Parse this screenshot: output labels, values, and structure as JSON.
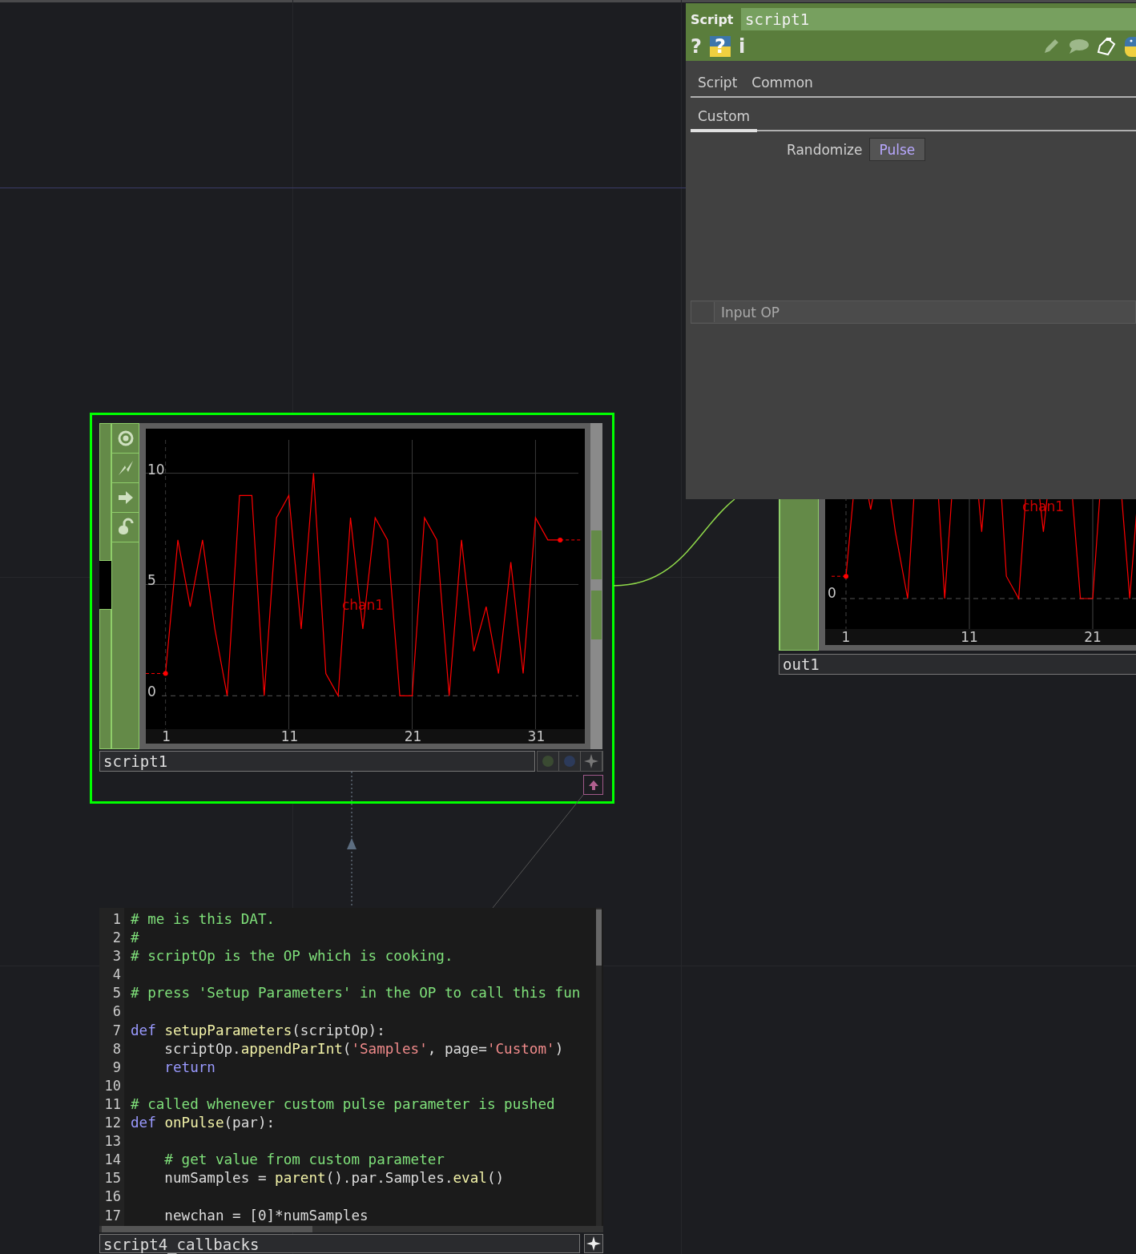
{
  "parameter_panel": {
    "type_label": "Script",
    "name": "script1",
    "header_buttons": [
      {
        "kind": "help",
        "glyph": "?"
      },
      {
        "kind": "python_help",
        "glyph": "?"
      },
      {
        "kind": "info",
        "glyph": "i"
      }
    ],
    "tab_rows": [
      [
        {
          "label": "Script",
          "selected": false
        },
        {
          "label": "Common",
          "selected": false
        }
      ],
      [
        {
          "label": "Custom",
          "selected": true
        }
      ]
    ],
    "parameters": [
      {
        "kind": "pulse",
        "label": "Randomize",
        "button": "Pulse"
      }
    ],
    "section_header": "Input OP"
  },
  "script_node": {
    "name": "script1",
    "selected": true,
    "chart_data": {
      "type": "line",
      "x": [
        1,
        2,
        3,
        4,
        5,
        6,
        7,
        8,
        9,
        10,
        11,
        12,
        13,
        14,
        15,
        16,
        17,
        18,
        19,
        20,
        21,
        22,
        23,
        24,
        25,
        26,
        27,
        28,
        29,
        30,
        31,
        32,
        33
      ],
      "series": [
        {
          "name": "chan1",
          "color": "#ff0000",
          "values": [
            1,
            7,
            4,
            7,
            3,
            0,
            9,
            9,
            0,
            8,
            9,
            3,
            10,
            1,
            0,
            8,
            3,
            8,
            7,
            0,
            0,
            8,
            7,
            0,
            7,
            2,
            4,
            1,
            6,
            1,
            8,
            7,
            7
          ]
        }
      ],
      "xticks": [
        1,
        11,
        21,
        31
      ],
      "yticks": [
        0,
        5,
        10
      ],
      "xlim": [
        -0.6,
        35
      ],
      "ylim": [
        -1.5,
        12
      ],
      "grid": true,
      "ref_lines": [
        {
          "axis": "x",
          "value": 1
        },
        {
          "axis": "y",
          "value": 0
        }
      ]
    }
  },
  "out_node": {
    "name": "out1",
    "channel_label": "chan1",
    "y_labels": [
      "0"
    ],
    "x_labels": [
      "1",
      "11",
      "21"
    ]
  },
  "callbacks_dat": {
    "name": "script4_callbacks",
    "lines": [
      {
        "number": "1",
        "segments": [
          {
            "kind": "comment",
            "text": "# me is this DAT."
          }
        ]
      },
      {
        "number": "2",
        "segments": [
          {
            "kind": "comment",
            "text": "#"
          }
        ]
      },
      {
        "number": "3",
        "segments": [
          {
            "kind": "comment",
            "text": "# scriptOp is the OP which is cooking."
          }
        ]
      },
      {
        "number": "4"
      },
      {
        "number": "5",
        "segments": [
          {
            "kind": "comment",
            "text": "# press 'Setup Parameters' in the OP to call this fun"
          }
        ]
      },
      {
        "number": "6"
      },
      {
        "number": "7",
        "segments": [
          {
            "kind": "keyword",
            "text": "def "
          },
          {
            "kind": "name",
            "text": "setupParameters"
          },
          {
            "kind": "plain",
            "text": "(scriptOp):"
          }
        ]
      },
      {
        "number": "8",
        "segments": [
          {
            "kind": "plain",
            "text": "    scriptOp."
          },
          {
            "kind": "name",
            "text": "appendParInt"
          },
          {
            "kind": "plain",
            "text": "("
          },
          {
            "kind": "string",
            "text": "'Samples'"
          },
          {
            "kind": "plain",
            "text": ", page="
          },
          {
            "kind": "string",
            "text": "'Custom'"
          },
          {
            "kind": "plain",
            "text": ")"
          }
        ]
      },
      {
        "number": "9",
        "segments": [
          {
            "kind": "keyword",
            "text": "    return"
          }
        ]
      },
      {
        "number": "10"
      },
      {
        "number": "11",
        "segments": [
          {
            "kind": "comment",
            "text": "# called whenever custom pulse parameter is pushed"
          }
        ]
      },
      {
        "number": "12",
        "segments": [
          {
            "kind": "keyword",
            "text": "def "
          },
          {
            "kind": "name",
            "text": "onPulse"
          },
          {
            "kind": "plain",
            "text": "(par):"
          }
        ]
      },
      {
        "number": "13"
      },
      {
        "number": "14",
        "segments": [
          {
            "kind": "comment",
            "text": "    # get value from custom parameter"
          }
        ]
      },
      {
        "number": "15",
        "segments": [
          {
            "kind": "plain",
            "text": "    numSamples = "
          },
          {
            "kind": "name",
            "text": "parent"
          },
          {
            "kind": "plain",
            "text": "().par.Samples."
          },
          {
            "kind": "name",
            "text": "eval"
          },
          {
            "kind": "plain",
            "text": "()"
          }
        ]
      },
      {
        "number": "16"
      },
      {
        "number": "17",
        "segments": [
          {
            "kind": "plain",
            "text": "    newchan = [0]*numSamples"
          }
        ]
      }
    ]
  }
}
